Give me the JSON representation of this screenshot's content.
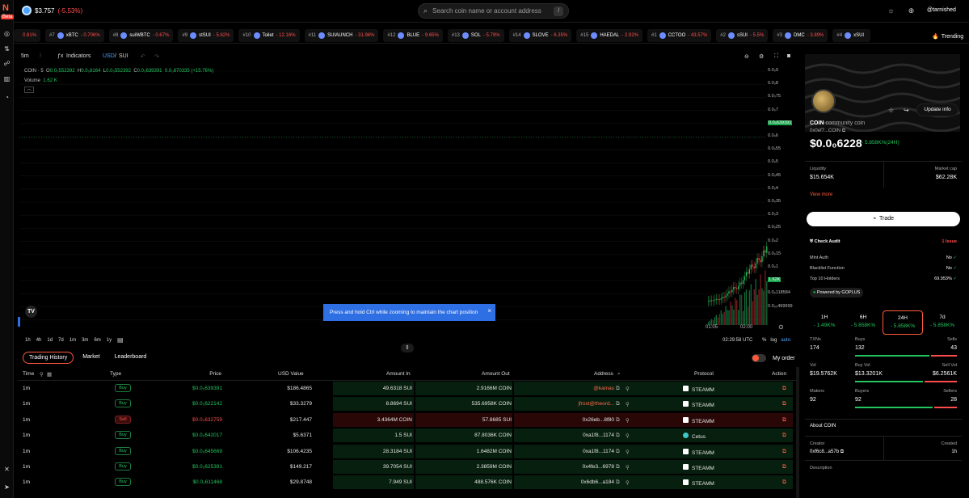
{
  "rail": {
    "logo": "N",
    "beta": "Beta"
  },
  "header": {
    "sui_price": "$3.757",
    "sui_change": "(-5.53%)",
    "search_placeholder": "Search coin name or account address",
    "search_key": "/",
    "username": "@tarnished"
  },
  "ticker": {
    "items": [
      {
        "rank": "",
        "name": "",
        "change": "0.81%"
      },
      {
        "rank": "#7",
        "name": "xBTC",
        "change": "- 0.706%"
      },
      {
        "rank": "#8",
        "name": "suiWBTC",
        "change": "- 0.67%"
      },
      {
        "rank": "#9",
        "name": "stSUI",
        "change": "- 5.62%"
      },
      {
        "rank": "#10",
        "name": "Toilet",
        "change": "- 12.16%"
      },
      {
        "rank": "#11",
        "name": "SUIAUNCH",
        "change": "- 31.96%"
      },
      {
        "rank": "#12",
        "name": "BLUE",
        "change": "- 9.65%"
      },
      {
        "rank": "#13",
        "name": "SOL",
        "change": "- 5.79%"
      },
      {
        "rank": "#14",
        "name": "SLOVE",
        "change": "- 6.35%"
      },
      {
        "rank": "#15",
        "name": "HAEDAL",
        "change": "- 2.92%"
      },
      {
        "rank": "#1",
        "name": "CCTOO",
        "change": "- 43.57%"
      },
      {
        "rank": "#2",
        "name": "sSUI",
        "change": "- 5.5%"
      },
      {
        "rank": "#3",
        "name": "DMC",
        "change": "- 3.89%"
      },
      {
        "rank": "#4",
        "name": "xSUI",
        "change": ""
      }
    ],
    "trending_label": "Trending"
  },
  "toolbar": {
    "interval": "5m",
    "indicators": "Indicators",
    "usd": "USD",
    "sep": "/",
    "sui": "SUI"
  },
  "chart_legend": {
    "symbol": "COIN · 5",
    "o_label": "O",
    "o_val": "0.0₀552392",
    "h_label": "H",
    "h_val": "0.0₀8164",
    "l_label": "L",
    "l_val": "0.0₀552392",
    "c_label": "C",
    "c_val": "0.0₀639391",
    "chg": "0.0₀870335 (+15.76%)",
    "volume_label": "Volume",
    "volume_val": "1.62 K"
  },
  "yaxis": {
    "labels": [
      "0.0₀9",
      "0.0₀8",
      "0.0₀75",
      "0.0₀7",
      "0.0₀639391",
      "0.0₀6",
      "0.0₀55",
      "0.0₀5",
      "0.0₀45",
      "0.0₀4",
      "0.0₀35",
      "0.0₀3",
      "0.0₀25",
      "0.0₀2",
      "0.0₀15",
      "0.0₀1",
      "1.62K",
      "0.0₀118584",
      "0.0₀₀499999"
    ]
  },
  "xaxis": {
    "t1": "01:05",
    "t2": "02:00"
  },
  "toast": {
    "text": "Press and hold Ctrl while zooming to maintain the chart position"
  },
  "timeframes": [
    "1h",
    "4h",
    "1d",
    "7d",
    "1m",
    "3m",
    "6m",
    "1y"
  ],
  "time_utc": "02:29:58 UTC",
  "scale": {
    "pct": "%",
    "log": "log",
    "auto": "auto"
  },
  "tabs": {
    "trading_history": "Trading History",
    "market": "Market",
    "leaderboard": "Leaderboard",
    "my_order": "My order"
  },
  "table": {
    "headers": {
      "time": "Time",
      "type": "Type",
      "price": "Price",
      "usd": "USD Value",
      "amount_in": "Amount In",
      "amount_out": "Amount Out",
      "address": "Address",
      "protocol": "Protocol",
      "action": "Action"
    },
    "rows": [
      {
        "time": "1m",
        "type": "Buy",
        "price": "$0.0₀639391",
        "usd": "$186.4865",
        "in": "49.6318 SUI",
        "out": "2.9166M COIN",
        "addr": "@kamas",
        "proto": "STEAMM"
      },
      {
        "time": "1m",
        "type": "Buy",
        "price": "$0.0₀622142",
        "usd": "$33.3279",
        "in": "8.8694 SUI",
        "out": "535.6958K COIN",
        "addr": "jfrost@theord...",
        "proto": "STEAMM"
      },
      {
        "time": "1m",
        "type": "Sell",
        "price": "$0.0₀632759",
        "usd": "$217.447",
        "in": "3.4364M COIN",
        "out": "57.8685 SUI",
        "addr": "0x26eb...8f80",
        "proto": "STEAMM"
      },
      {
        "time": "1m",
        "type": "Buy",
        "price": "$0.0₀642017",
        "usd": "$5.6371",
        "in": "1.5 SUI",
        "out": "87.8036K COIN",
        "addr": "0xa1f8...1174",
        "proto": "Cetus"
      },
      {
        "time": "1m",
        "type": "Buy",
        "price": "$0.0₀645669",
        "usd": "$106.4235",
        "in": "28.3184 SUI",
        "out": "1.6482M COIN",
        "addr": "0xa1f8...1174",
        "proto": "STEAMM"
      },
      {
        "time": "1m",
        "type": "Buy",
        "price": "$0.0₀625391",
        "usd": "$149.217",
        "in": "39.7054 SUI",
        "out": "2.3859M COIN",
        "addr": "0x4fe3...6978",
        "proto": "STEAMM"
      },
      {
        "time": "1m",
        "type": "Buy",
        "price": "$0.0₀611468",
        "usd": "$29.8748",
        "in": "7.949 SUI",
        "out": "488.576K COIN",
        "addr": "0x6db6...a184",
        "proto": "STEAMM"
      }
    ]
  },
  "coin": {
    "symbol": "COIN",
    "name": "community coin",
    "address": "0x0ef7...COIN",
    "price": "$0.0₀6228",
    "change": "- 5.858K%(24H)",
    "update_info": "Update info",
    "liquidity_label": "Liquidity",
    "liquidity": "$15.654K",
    "mcap_label": "Market cap",
    "mcap": "$62.28K",
    "view_more": "View more",
    "trade": "Trade"
  },
  "audit": {
    "title": "Check Audit",
    "issues": "1 Issue",
    "mint_label": "Mint Auth",
    "mint_val": "No",
    "blacklist_label": "Blacklist Function",
    "blacklist_val": "No",
    "top10_label": "Top 10 Holders",
    "top10_val": "69.953%",
    "powered": "Powered by GOPLUS"
  },
  "tf_stats": [
    {
      "label": "1H",
      "val": "- 1.49K%"
    },
    {
      "label": "6H",
      "val": "- 5.858K%"
    },
    {
      "label": "24H",
      "val": "- 5.858K%"
    },
    {
      "label": "7d",
      "val": "- 5.858K%"
    }
  ],
  "stats": {
    "txns_label": "TXNs",
    "txns": "174",
    "buys_label": "Buys",
    "buys": "132",
    "sells_label": "Sells",
    "sells": "43",
    "vol_label": "Vol",
    "vol": "$19.5762K",
    "buyvol_label": "Buy Vol",
    "buyvol": "$13.3201K",
    "sellvol_label": "Sell Vol",
    "sellvol": "$6.2561K",
    "makers_label": "Makers",
    "makers": "92",
    "buyers_label": "Buyers",
    "buyers": "92",
    "sellers_label": "Sellers",
    "sellers": "28"
  },
  "about": {
    "title": "About COIN",
    "creator_label": "Creator",
    "creator": "0xf6c8...a57b",
    "created_label": "Created",
    "created": "1h",
    "desc_label": "Description"
  },
  "colors": {
    "accent": "#ff5a3c",
    "green": "#22c55e",
    "red": "#ff4d4d",
    "blue": "#2f6fe4"
  }
}
